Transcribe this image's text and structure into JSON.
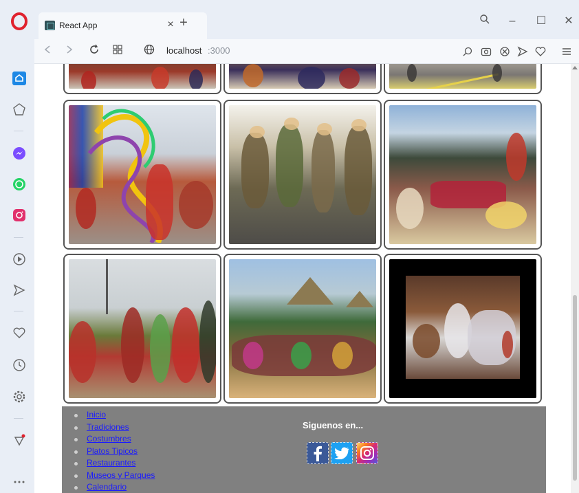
{
  "browser": {
    "tab_title": "React App",
    "tab_close": "×",
    "new_tab": "+",
    "url_host": "localhost",
    "url_port": ":3000",
    "accent_color": "#e0222e"
  },
  "window_controls": {
    "minimize": "–",
    "maximize": "☐",
    "close": "✕"
  },
  "sidebar_icons": [
    "home-icon",
    "speed-dial-icon",
    "messenger-icon",
    "whatsapp-icon",
    "instagram-icon",
    "player-icon",
    "flow-icon",
    "bookmarks-icon",
    "history-icon",
    "settings-icon",
    "pinboard-icon",
    "more-icon"
  ],
  "gallery": {
    "rows": [
      [
        "dancers-red-costumes",
        "parade-dancers",
        "street-festival"
      ],
      [
        "ribbon-festival",
        "masked-dancers",
        "flower-offering"
      ],
      [
        "folk-dance-street",
        "indigenous-dance-village",
        "couple-dance"
      ]
    ]
  },
  "footer": {
    "links": [
      "Inicio",
      "Tradiciones",
      "Costumbres",
      "Platos Tipicos",
      "Restaurantes",
      "Museos y Parques",
      "Calendario"
    ],
    "social_title": "Siguenos en...",
    "social_icons": [
      "facebook-icon",
      "twitter-icon",
      "instagram-icon"
    ],
    "colors": {
      "background": "#808080",
      "link": "#1a1aff"
    }
  }
}
